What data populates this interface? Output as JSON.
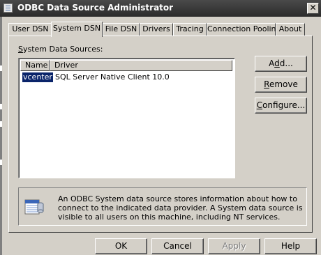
{
  "window": {
    "title": "ODBC Data Source Administrator",
    "close_glyph": "✕"
  },
  "tabs": [
    {
      "label": "User DSN",
      "active": false
    },
    {
      "label": "System DSN",
      "active": true
    },
    {
      "label": "File DSN",
      "active": false
    },
    {
      "label": "Drivers",
      "active": false
    },
    {
      "label": "Tracing",
      "active": false
    },
    {
      "label": "Connection Pooling",
      "active": false
    },
    {
      "label": "About",
      "active": false
    }
  ],
  "system_dsn": {
    "section_label_accel": "S",
    "section_label_rest": "ystem Data Sources:",
    "columns": [
      "Name",
      "Driver"
    ],
    "rows": [
      {
        "name": "vcenter",
        "driver": "SQL Server Native Client 10.0",
        "selected": true
      }
    ]
  },
  "side_buttons": {
    "add": {
      "accel": "d",
      "before": "A",
      "after": "d..."
    },
    "remove": {
      "accel": "R",
      "before": "",
      "after": "emove"
    },
    "configure": {
      "accel": "C",
      "before": "",
      "after": "onfigure..."
    }
  },
  "info": {
    "icon": "data-source-icon",
    "text": "An ODBC System data source stores information about how to connect to the indicated data provider.  A System data source is visible to all users on this machine, including NT services."
  },
  "dialog_buttons": {
    "ok": "OK",
    "cancel": "Cancel",
    "apply": "Apply",
    "help": "Help"
  },
  "colors": {
    "face": "#d4d0c8",
    "title_bar": "#333333",
    "selection": "#0a246a"
  }
}
